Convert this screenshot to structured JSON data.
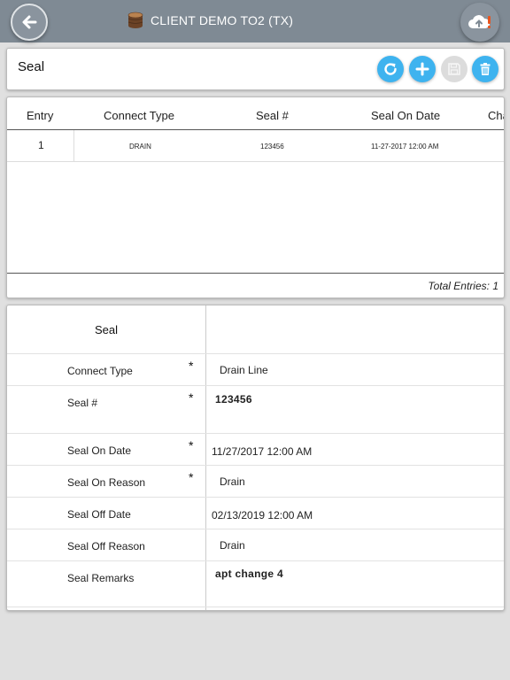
{
  "app": {
    "title": "CLIENT DEMO TO2 (TX)"
  },
  "header": {
    "title": "Seal"
  },
  "list": {
    "columns": [
      "Entry",
      "Connect Type",
      "Seal #",
      "Seal On Date",
      "Cha"
    ],
    "rows": [
      {
        "entry": "1",
        "connect_type": "DRAIN",
        "seal_no": "123456",
        "seal_on_date": "11-27-2017 12:00 AM"
      }
    ],
    "total_label": "Total Entries: 1"
  },
  "form": {
    "title": "Seal",
    "fields": [
      {
        "label": "Connect Type",
        "required": "*",
        "value": "Drain Line"
      },
      {
        "label": "Seal #",
        "required": "*",
        "value": "123456"
      },
      {
        "label": "Seal On Date",
        "required": "*",
        "value": "11/27/2017 12:00 AM"
      },
      {
        "label": "Seal On Reason",
        "required": "*",
        "value": "Drain"
      },
      {
        "label": "Seal Off Date",
        "required": "",
        "value": "02/13/2019 12:00 AM"
      },
      {
        "label": "Seal Off Reason",
        "required": "",
        "value": "Drain"
      },
      {
        "label": "Seal Remarks",
        "required": "",
        "value": "apt change 4"
      }
    ]
  },
  "colors": {
    "topbar": "#7f8a94",
    "accent": "#3eb3ef",
    "alert": "#e8541e"
  },
  "icons": [
    "back-arrow-icon",
    "database-icon",
    "cloud-upload-icon",
    "refresh-icon",
    "add-icon",
    "save-icon",
    "trash-icon"
  ]
}
